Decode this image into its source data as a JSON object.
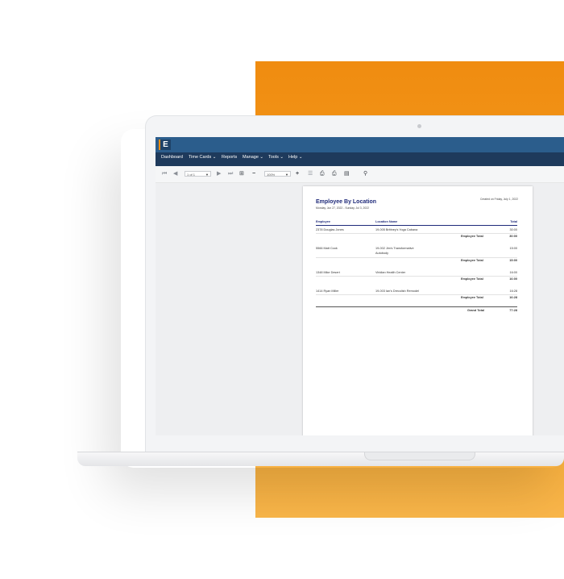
{
  "menu": [
    "Dashboard",
    "Time Cards ⌄",
    "Reports",
    "Manage ⌄",
    "Tools ⌄",
    "Help ⌄"
  ],
  "logo_letter": "E",
  "toolbar": {
    "page_select": "1 of 1",
    "zoom_select": "100%"
  },
  "report": {
    "title": "Employee By Location",
    "date_range": "Monday, Jun 27, 2022 - Sunday, Jul 3, 2022",
    "created": "Created on Friday, July 1, 2022",
    "headers": {
      "employee": "Employee",
      "location": "Location Name",
      "total": "Total"
    },
    "rows": [
      {
        "employee": "2378  Douglas Jones",
        "location": "19-005  Brittney's Yoga Cabana",
        "location2": "",
        "total": "30:00",
        "emp_total_label": "Employee Total",
        "emp_total": "30:00"
      },
      {
        "employee": "5566  Matt Cook",
        "location": "19-002  Jim's Transformative",
        "location2": "Autobody",
        "total": "15:00",
        "emp_total_label": "Employee Total",
        "emp_total": "15:00"
      },
      {
        "employee": "1348  Mike Desert",
        "location": "Viridian Health Center",
        "location2": "",
        "total": "16:00",
        "emp_total_label": "Employee Total",
        "emp_total": "16:00"
      },
      {
        "employee": "1414  Ryan Miller",
        "location": "19-003  Ian's Drecolish Remodel",
        "location2": "",
        "total": "16:28",
        "emp_total_label": "Employee Total",
        "emp_total": "16:28"
      }
    ],
    "grand_total_label": "Grand Total",
    "grand_total": "77:28"
  },
  "colors": {
    "appbar": "#2b5d8c",
    "menubar": "#1e3a5c",
    "accent": "#f08c10",
    "report_title": "#1f2a7a"
  }
}
